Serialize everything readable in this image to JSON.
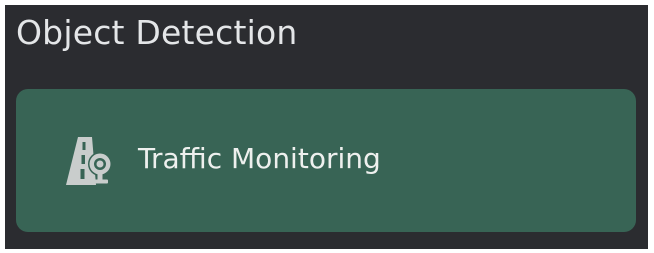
{
  "section": {
    "title": "Object Detection"
  },
  "options": [
    {
      "label": "Traffic Monitoring",
      "icon": "traffic-camera-road-icon"
    }
  ],
  "colors": {
    "panel_background": "#2b2c30",
    "card_background": "#386455",
    "text": "#e4e6e8",
    "icon": "#c9cdcc"
  }
}
